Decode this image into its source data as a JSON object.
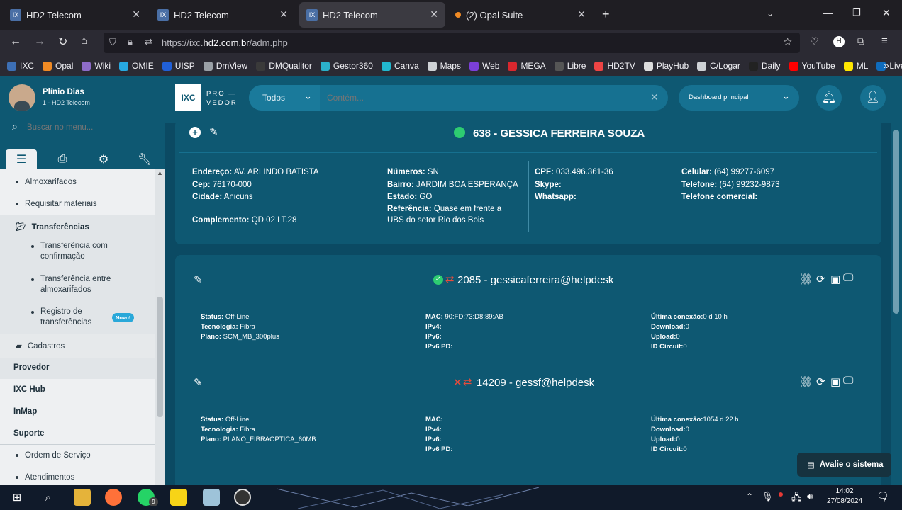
{
  "browser": {
    "tabs": [
      {
        "label": "HD2 Telecom"
      },
      {
        "label": "HD2 Telecom"
      },
      {
        "label": "HD2 Telecom"
      },
      {
        "label": "(2) Opal Suite"
      }
    ],
    "url_prefix": "https://ixc.",
    "url_host": "hd2.com.br",
    "url_path": "/adm.php",
    "bookmarks": [
      {
        "label": "IXC",
        "color": "#3d6fb5"
      },
      {
        "label": "Opal",
        "color": "#f08a24"
      },
      {
        "label": "Wiki",
        "color": "#8e6cc9"
      },
      {
        "label": "OMIE",
        "color": "#27a9e1"
      },
      {
        "label": "UISP",
        "color": "#2160d8"
      },
      {
        "label": "DmView",
        "color": "#9aa0a6"
      },
      {
        "label": "DMQualitor",
        "color": "#3a3a3a"
      },
      {
        "label": "Gestor360",
        "color": "#2bb0c9"
      },
      {
        "label": "Canva",
        "color": "#22b8cf"
      },
      {
        "label": "Maps",
        "color": "#cfd2d6"
      },
      {
        "label": "Web",
        "color": "#7b3fd8"
      },
      {
        "label": "MEGA",
        "color": "#d9272e"
      },
      {
        "label": "Libre",
        "color": "#555"
      },
      {
        "label": "HD2TV",
        "color": "#e44"
      },
      {
        "label": "PlayHub",
        "color": "#ddd"
      },
      {
        "label": "C/Logar",
        "color": "#cfd2d6"
      },
      {
        "label": "Daily",
        "color": "#222"
      },
      {
        "label": "YouTube",
        "color": "#ff0000"
      },
      {
        "label": "ML",
        "color": "#ffe600"
      },
      {
        "label": "Live",
        "color": "#0f6cbd"
      }
    ]
  },
  "user": {
    "name": "Plínio Dias",
    "company": "1 - HD2 Telecom"
  },
  "sidebar": {
    "search_placeholder": "Buscar no menu...",
    "items": [
      {
        "label": "Almoxarifados"
      },
      {
        "label": "Requisitar materiais"
      },
      {
        "label": "Transferências"
      },
      {
        "label": "Transferência com confirmação"
      },
      {
        "label": "Transferência entre almoxarifados"
      },
      {
        "label": "Registro de transferências"
      },
      {
        "label": "Cadastros"
      },
      {
        "label": "Provedor"
      },
      {
        "label": "IXC Hub"
      },
      {
        "label": "InMap"
      },
      {
        "label": "Suporte"
      },
      {
        "label": "Ordem de Serviço"
      },
      {
        "label": "Atendimentos"
      }
    ],
    "new_badge": "Novo!"
  },
  "header": {
    "logo": "IXC",
    "brand_line1": "PRO —",
    "brand_line2": "VEDOR",
    "filter_selected": "Todos",
    "search_placeholder": "Contém...",
    "dashboard_selected": "Dashboard principal"
  },
  "client": {
    "title": "638 - GESSICA FERREIRA SOUZA",
    "col1": [
      {
        "k": "Endereço:",
        "v": "AV. ARLINDO BATISTA"
      },
      {
        "k": "Cep:",
        "v": "76170-000"
      },
      {
        "k": "Cidade:",
        "v": "Anicuns"
      },
      {
        "k": "Complemento:",
        "v": "QD 02 LT.28"
      }
    ],
    "col2": [
      {
        "k": "Números:",
        "v": "SN"
      },
      {
        "k": "Bairro:",
        "v": "JARDIM BOA ESPERANÇA"
      },
      {
        "k": "Estado:",
        "v": "GO"
      },
      {
        "k": "Referência:",
        "v": "Quase em frente a"
      }
    ],
    "col2_extra": "UBS do setor Rio dos Bois",
    "col3": [
      {
        "k": "CPF:",
        "v": "033.496.361-36"
      },
      {
        "k": "Skype:",
        "v": ""
      },
      {
        "k": "Whatsapp:",
        "v": ""
      }
    ],
    "col4": [
      {
        "k": "Celular:",
        "v": "(64) 99277-6097"
      },
      {
        "k": "Telefone:",
        "v": "(64) 99232-9873"
      },
      {
        "k": "Telefone comercial:",
        "v": ""
      }
    ]
  },
  "logins": [
    {
      "title": "2085 - gessicaferreira@helpdesk",
      "active": true,
      "left": [
        {
          "k": "Status:",
          "v": "Off-Line"
        },
        {
          "k": "Tecnologia:",
          "v": "Fibra"
        },
        {
          "k": "Plano:",
          "v": "SCM_MB_300plus"
        }
      ],
      "mid": [
        {
          "k": "MAC:",
          "v": "90:FD:73:D8:89:AB"
        },
        {
          "k": "IPv4:",
          "v": ""
        },
        {
          "k": "IPv6:",
          "v": ""
        },
        {
          "k": "IPv6 PD:",
          "v": ""
        }
      ],
      "right": [
        {
          "k": "Última conexão:",
          "v": "0 d 10 h"
        },
        {
          "k": "Download:",
          "v": "0"
        },
        {
          "k": "Upload:",
          "v": "0"
        },
        {
          "k": "ID Circuit:",
          "v": "0"
        }
      ]
    },
    {
      "title": "14209 - gessf@helpdesk",
      "active": false,
      "left": [
        {
          "k": "Status:",
          "v": "Off-Line"
        },
        {
          "k": "Tecnologia:",
          "v": "Fibra"
        },
        {
          "k": "Plano:",
          "v": "PLANO_FIBRAOPTICA_60MB"
        }
      ],
      "mid": [
        {
          "k": "MAC:",
          "v": ""
        },
        {
          "k": "IPv4:",
          "v": ""
        },
        {
          "k": "IPv6:",
          "v": ""
        },
        {
          "k": "IPv6 PD:",
          "v": ""
        }
      ],
      "right": [
        {
          "k": "Última conexão:",
          "v": "1054 d 22 h"
        },
        {
          "k": "Download:",
          "v": "0"
        },
        {
          "k": "Upload:",
          "v": "0"
        },
        {
          "k": "ID Circuit:",
          "v": "0"
        }
      ]
    }
  ],
  "feedback_button": "Avalie o sistema",
  "taskbar": {
    "time": "14:02",
    "date": "27/08/2024",
    "whatsapp_count": "9",
    "notif_count": "7"
  }
}
